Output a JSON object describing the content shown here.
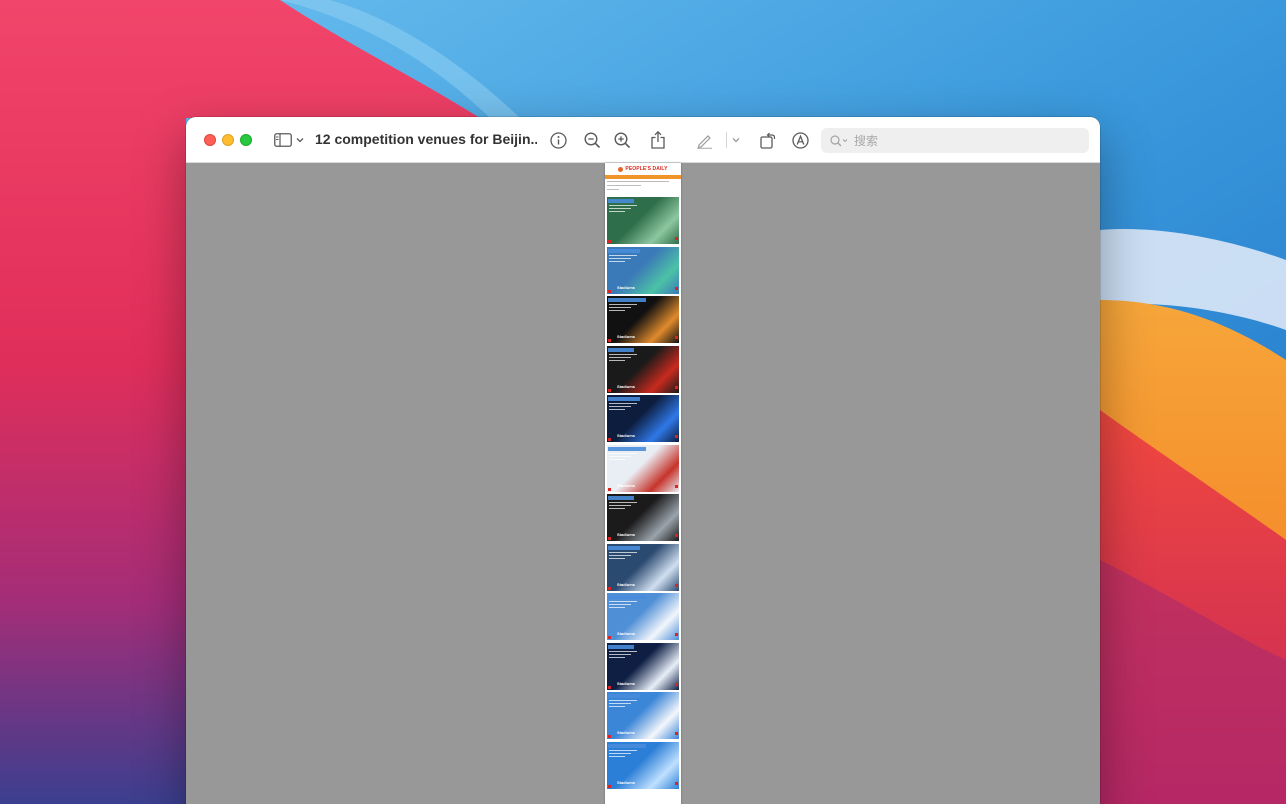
{
  "window": {
    "title": "12 competition venues for Beijin...",
    "search_placeholder": "搜索"
  },
  "toolbar": {
    "icons": [
      "sidebar-toggle-icon",
      "chevron-down-icon",
      "info-icon",
      "zoom-out-icon",
      "zoom-in-icon",
      "share-icon",
      "highlight-pen-icon",
      "chevron-down-icon",
      "rotate-icon",
      "markup-icon",
      "search-icon"
    ]
  },
  "document": {
    "masthead": "PEOPLE'S DAILY",
    "slides": [
      {
        "theme": "#2f6e4a",
        "accent": "#8cc7a0"
      },
      {
        "theme": "#3b7ab8",
        "accent": "#4cc2a6"
      },
      {
        "theme": "#111111",
        "accent": "#e08a2c"
      },
      {
        "theme": "#1a1a1a",
        "accent": "#c82a1e"
      },
      {
        "theme": "#0d1d3d",
        "accent": "#2f78e8"
      },
      {
        "theme": "#e9eef4",
        "accent": "#c6342b"
      },
      {
        "theme": "#1b1b1b",
        "accent": "#9aa3ab"
      },
      {
        "theme": "#2b4a70",
        "accent": "#d0dff0"
      },
      {
        "theme": "#4f8fd6",
        "accent": "#f2f6fb"
      },
      {
        "theme": "#0f1f44",
        "accent": "#e7eef7"
      },
      {
        "theme": "#3c86d8",
        "accent": "#f4f7fb"
      },
      {
        "theme": "#2c7fd6",
        "accent": "#bfe0ff"
      }
    ],
    "slide_logo": "Stadiums"
  },
  "colors": {
    "close": "#fe5f57",
    "minimize": "#febc2e",
    "maximize": "#28c840",
    "content_bg": "#989898",
    "masthead": "#d9291c",
    "header_bar": "#f0932b"
  }
}
